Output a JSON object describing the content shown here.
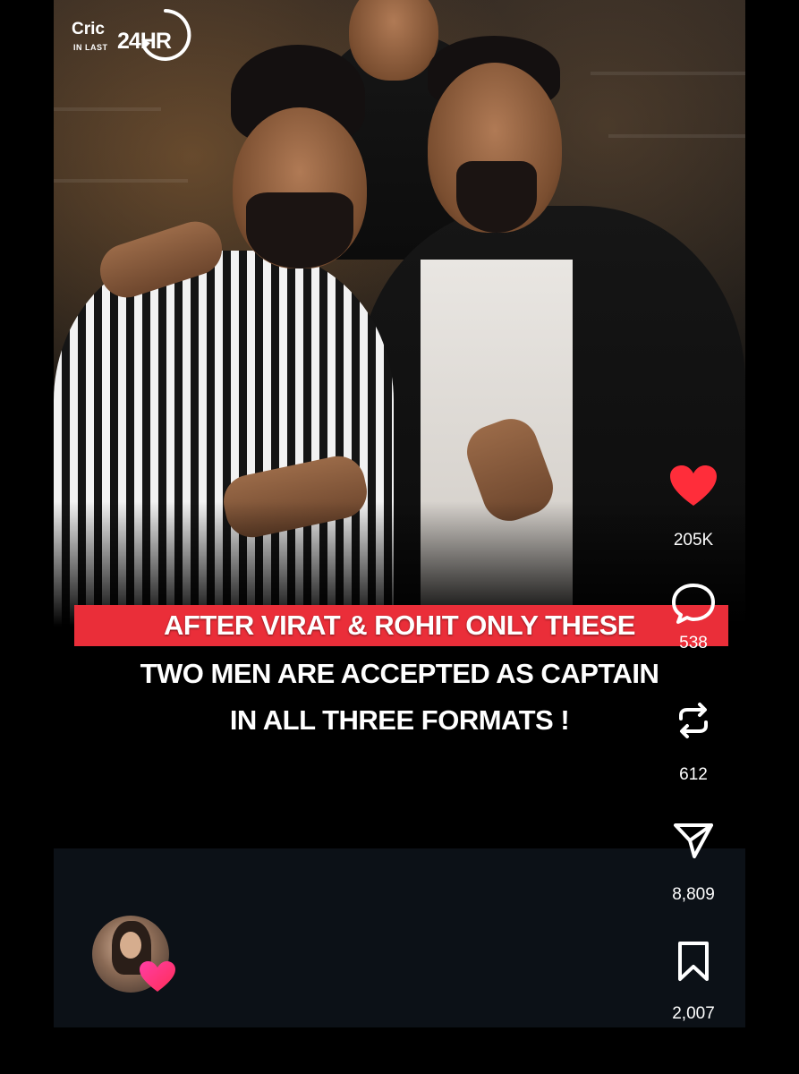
{
  "logo": {
    "brand_top": "Cric",
    "brand_small": "IN LAST",
    "brand_big": "24HR"
  },
  "headline": {
    "line1": "AFTER VIRAT & ROHIT ONLY THESE",
    "line2": "TWO MEN ARE ACCEPTED AS CAPTAIN",
    "line3": "IN ALL THREE FORMATS !",
    "highlight_color": "#ea2e39"
  },
  "actions": {
    "like": {
      "icon": "heart-icon",
      "count": "205K",
      "color": "#ff2d3a"
    },
    "comment": {
      "icon": "comment-bubble-icon",
      "count": "538"
    },
    "repost": {
      "icon": "repost-arrows-icon",
      "count": "612"
    },
    "share": {
      "icon": "paper-plane-icon",
      "count": "8,809"
    },
    "save": {
      "icon": "bookmark-icon",
      "count": "2,007"
    }
  },
  "author": {
    "avatar": "profile-avatar",
    "badge": "heart-badge-icon"
  }
}
